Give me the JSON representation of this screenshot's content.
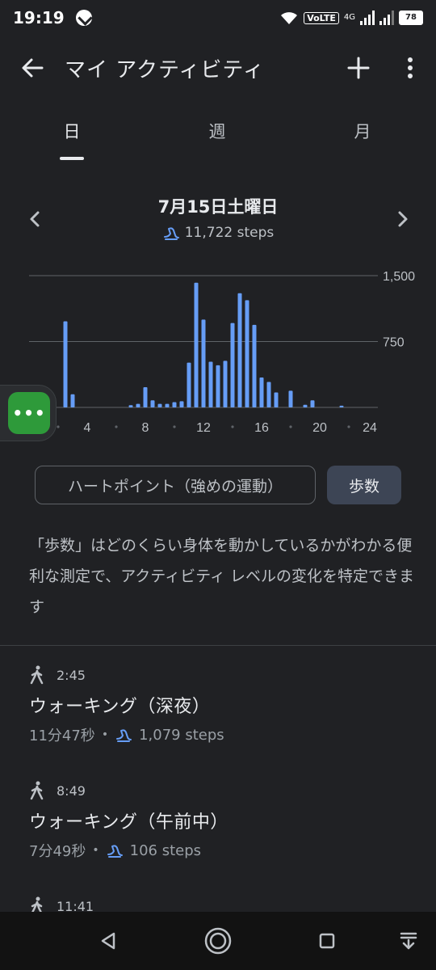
{
  "status": {
    "time": "19:19",
    "volte": "VoLTE",
    "network": "4G",
    "battery": "78"
  },
  "app_bar": {
    "title": "マイ アクティビティ"
  },
  "tabs": [
    {
      "label": "日",
      "active": true
    },
    {
      "label": "週",
      "active": false
    },
    {
      "label": "月",
      "active": false
    }
  ],
  "date_nav": {
    "date": "7月15日土曜日",
    "steps": "11,722 steps"
  },
  "chart_data": {
    "type": "bar",
    "xlabel": "",
    "ylabel": "",
    "x_ticks": [
      "0",
      "4",
      "8",
      "12",
      "16",
      "20",
      "24"
    ],
    "y_ticks": [
      "750",
      "1,500"
    ],
    "ylim": [
      0,
      1500
    ],
    "xlim": [
      0,
      24
    ],
    "bar_color": "#669df6",
    "hours": [
      2.5,
      3.0,
      7.0,
      7.5,
      8.0,
      8.5,
      9.0,
      9.5,
      10.0,
      10.5,
      11.0,
      11.5,
      12.0,
      12.5,
      13.0,
      13.5,
      14.0,
      14.5,
      15.0,
      15.5,
      16.0,
      16.5,
      17.0,
      18.0,
      19.0,
      19.5,
      21.5
    ],
    "values": [
      980,
      150,
      25,
      40,
      230,
      80,
      40,
      40,
      60,
      70,
      510,
      1420,
      1000,
      520,
      480,
      530,
      960,
      1300,
      1220,
      940,
      340,
      290,
      170,
      190,
      30,
      80,
      20
    ],
    "grid": true
  },
  "bubble": {
    "label": "•••"
  },
  "metric_toggle": {
    "heart_points": "ハートポイント（強めの運動）",
    "steps": "歩数"
  },
  "description": "「歩数」はどのくらい身体を動かしているかがわかる便利な測定で、アクティビティ レベルの変化を特定できます",
  "activities": [
    {
      "time": "2:45",
      "title": "ウォーキング（深夜）",
      "duration": "11分47秒",
      "steps": "1,079 steps"
    },
    {
      "time": "8:49",
      "title": "ウォーキング（午前中）",
      "duration": "7分49秒",
      "steps": "106 steps"
    },
    {
      "time": "11:41",
      "title": "",
      "duration": "",
      "steps": ""
    }
  ],
  "colors": {
    "background": "#202124",
    "accent_blue": "#669df6",
    "toggle_active": "#3d4555"
  }
}
